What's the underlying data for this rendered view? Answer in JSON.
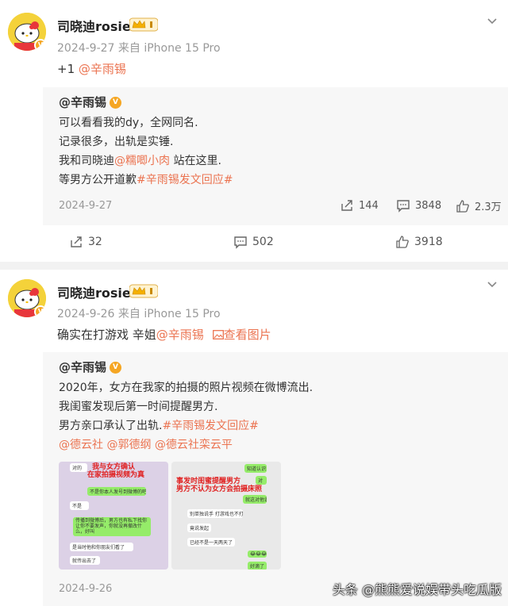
{
  "post1": {
    "username": "司晓迪rosie",
    "meta": "2024-9-27 来自 iPhone 15 Pro",
    "text_prefix": "+1 ",
    "mention": "@辛雨锡",
    "quote": {
      "author": "@辛雨锡",
      "line1": "可以看看我的dy，全网同名.",
      "line2": "记录很多，出轨是实锤.",
      "line3_pre": "我和司晓迪",
      "line3_mention": "@糯唧小肉",
      "line3_post": " 站在这里.",
      "line4_pre": "等男方公开道歉",
      "line4_tag": "#辛雨锡发文回应#",
      "date": "2024-9-27",
      "stats": {
        "shares": "144",
        "comments": "3848",
        "likes": "2.3万"
      }
    },
    "stats": {
      "shares": "32",
      "comments": "502",
      "likes": "3918"
    }
  },
  "post2": {
    "username": "司晓迪rosie",
    "meta": "2024-9-26 来自 iPhone 15 Pro",
    "text": "确实在打游戏 辛姐",
    "mention": "@辛雨锡",
    "view_image": "查看图片",
    "quote": {
      "author": "@辛雨锡",
      "line1": "2020年，女方在我家的拍摄的照片视频在微博流出.",
      "line2": "我闺蜜发现后第一时间提醒男方.",
      "line3_pre": "男方亲口承认了出轨.",
      "line3_tag": "#辛雨锡发文回应#",
      "mentions": [
        "@德云社",
        "@郭德纲",
        "@德云社栾云平"
      ],
      "date": "2024-9-26"
    },
    "image1": {
      "title_line1": "我与女方确认",
      "title_line2": "在家拍摄视频为真",
      "msgs": [
        "对的",
        "不是你本人发号到微博的吧",
        "不是",
        "传播到微博后，男方也有私下找你让你不要发声，你就没再撤改什么，好叫",
        "是当时他和你朋友们看了",
        "就传出去了"
      ]
    },
    "image2": {
      "title_line1": "事发时闺蜜提醒男方",
      "title_line2": "男方不认为女方会拍摄床照",
      "msgs": [
        "知道认识",
        "对",
        "就这对他说",
        "别单独说手 打游戏也不打",
        "竟说发起",
        "已经不是一天两天了",
        "😂😂😂",
        "好滴了"
      ]
    }
  },
  "watermark": "头条 @熊熊爱说娱带头吃瓜版"
}
